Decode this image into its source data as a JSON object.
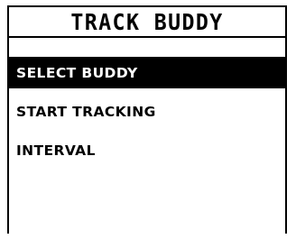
{
  "header": {
    "title": "TRACK BUDDY"
  },
  "menu": {
    "items": [
      {
        "label": "SELECT BUDDY",
        "selected": true
      },
      {
        "label": "START TRACKING",
        "selected": false
      },
      {
        "label": "INTERVAL",
        "selected": false
      }
    ]
  },
  "colors": {
    "background": "#ffffff",
    "foreground": "#000000",
    "highlight_bg": "#000000",
    "highlight_fg": "#ffffff"
  }
}
